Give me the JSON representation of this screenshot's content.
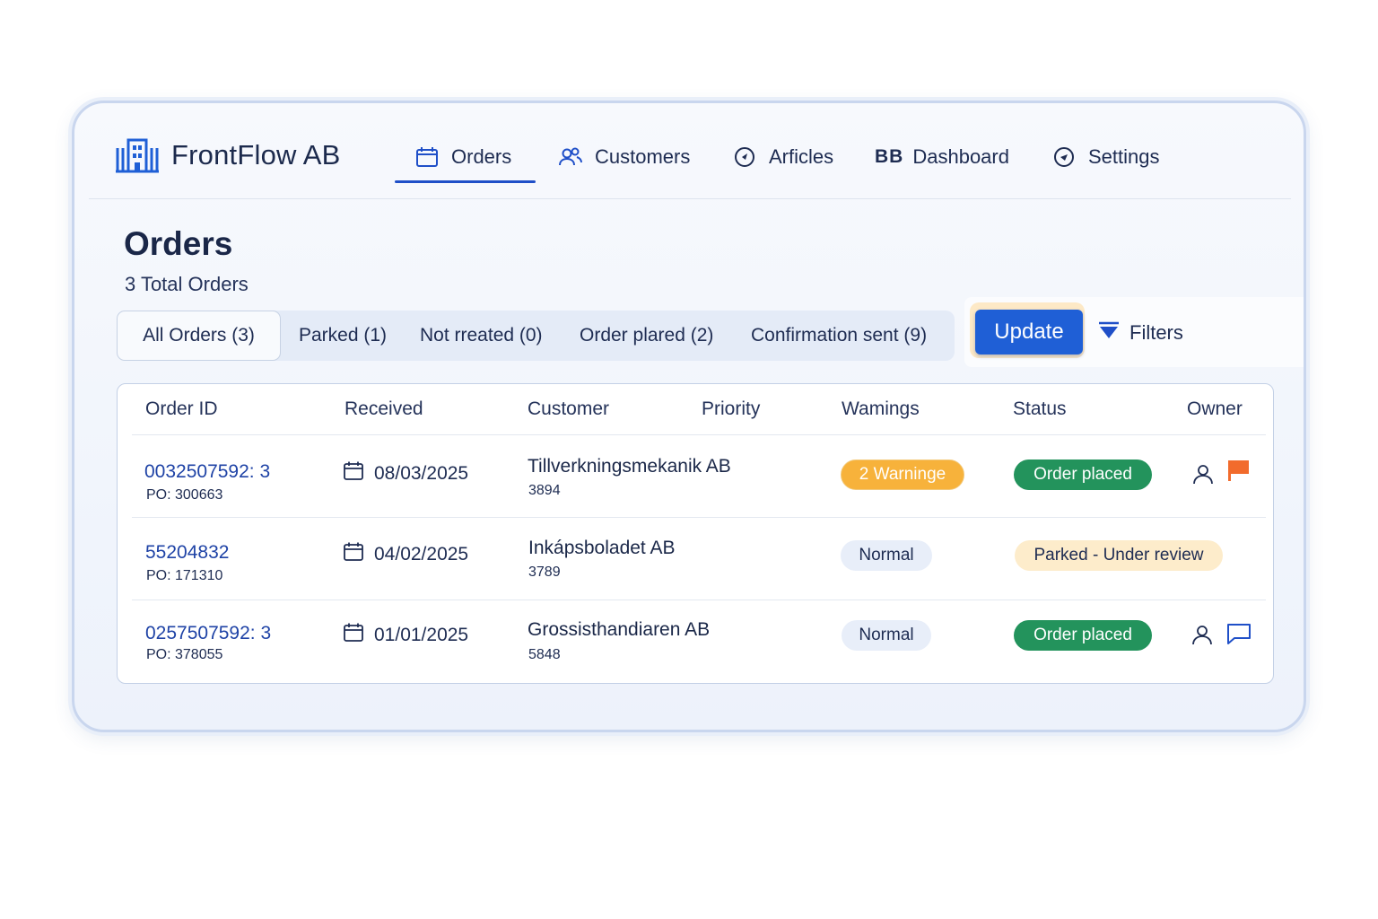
{
  "app": {
    "brand": "FrontFlow AB"
  },
  "nav": {
    "orders": "Orders",
    "customers": "Customers",
    "articles": "Arficles",
    "dashboard_prefix": "BB",
    "dashboard": "Dashboard",
    "settings": "Settings",
    "active": "Orders"
  },
  "page": {
    "title": "Orders",
    "subtitle": "3 Total Orders"
  },
  "tabs": [
    {
      "label": "All Orders (3)",
      "selected": true
    },
    {
      "label": "Parked (1)"
    },
    {
      "label": "Not rreated (0)"
    },
    {
      "label": "Order plared (2)"
    },
    {
      "label": "Confirmation sent (9)"
    }
  ],
  "actions": {
    "update": "Update",
    "filters": "Filters"
  },
  "table": {
    "headers": [
      "Order ID",
      "Received",
      "Customer",
      "Priority",
      "Wamings",
      "Status",
      "Owner"
    ],
    "rows": [
      {
        "order_id": "0032507592: 3",
        "po": "PO: 300663",
        "received": "08/03/2025",
        "customer": "Tillverkningsmekanik AB",
        "customer_no": "3894",
        "badge": "2 Warninge",
        "status": "Order placed",
        "owner_icons": [
          "user-icon",
          "flag-icon"
        ]
      },
      {
        "order_id": "55204832",
        "po": "PO: 171310",
        "received": "04/02/2025",
        "customer": "Inkápsboladet AB",
        "customer_no": "3789",
        "badge": "Normal",
        "status": "Parked - Under review",
        "owner_icons": []
      },
      {
        "order_id": "0257507592: 3",
        "po": "PO: 378055",
        "received": "01/01/2025",
        "customer": "Grossisthandiaren AB",
        "customer_no": "5848",
        "badge": "Normal",
        "status": "Order placed",
        "owner_icons": [
          "user-icon",
          "comment-icon"
        ]
      }
    ]
  },
  "colors": {
    "primary": "#1f5fd6",
    "link": "#1f43a6",
    "warning": "#f7b23b",
    "success": "#23935c",
    "parked": "#fdeccb",
    "flag": "#f26b2c"
  }
}
